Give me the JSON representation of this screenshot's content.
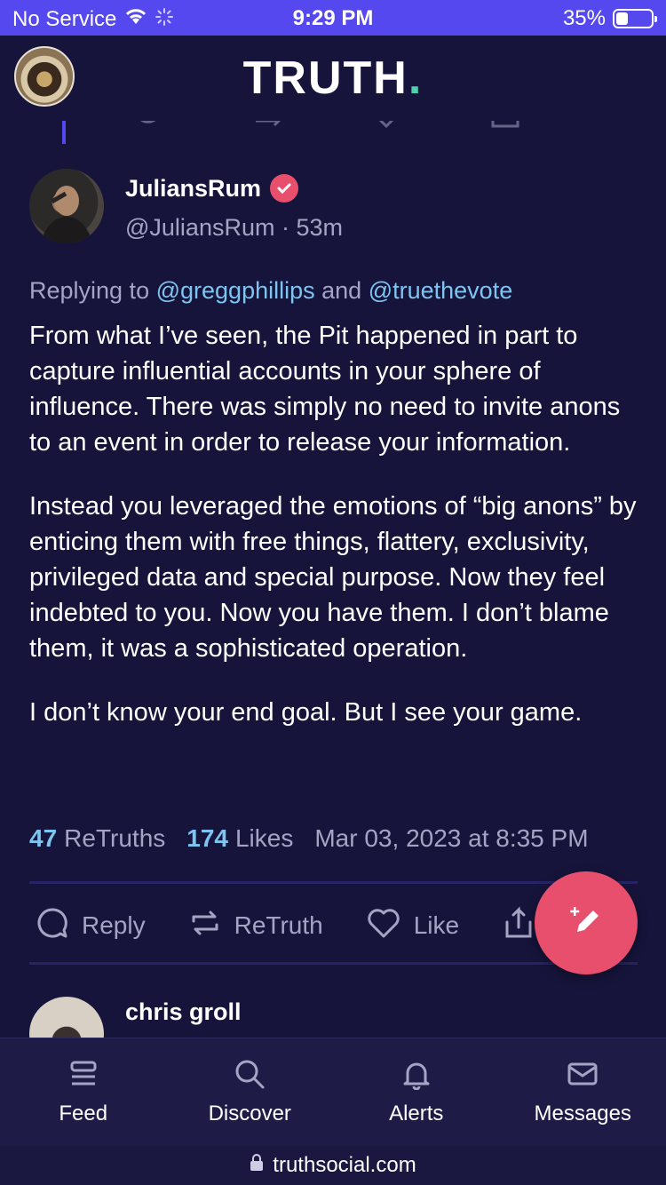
{
  "status_bar": {
    "carrier": "No Service",
    "time": "9:29 PM",
    "battery_percent": "35%",
    "battery_level": 0.35
  },
  "header": {
    "logo_text": "TRUTH",
    "logo_dot": "."
  },
  "post": {
    "author_name": "JuliansRum",
    "handle": "@JuliansRum",
    "separator": "·",
    "age": "53m",
    "replying_prefix": "Replying to",
    "replying_mentions": [
      "@greggphillips",
      "@truethevote"
    ],
    "replying_joiner": "and",
    "paragraphs": [
      "From what I’ve seen, the Pit happened in part to capture influential accounts in your sphere of influence. There was simply no need to invite anons to an event in order to release your information.",
      "Instead you leveraged the emotions of “big anons” by enticing them with free things, flattery, exclusivity, privileged data and special purpose. Now they feel indebted to you. Now you have them. I don’t blame them, it was a sophisticated operation.",
      "I don’t know your end goal. But I see your game."
    ],
    "retruths_count": "47",
    "retruths_label": "ReTruths",
    "likes_count": "174",
    "likes_label": "Likes",
    "timestamp": "Mar 03, 2023 at 8:35 PM"
  },
  "actions": {
    "reply": "Reply",
    "retruth": "ReTruth",
    "like": "Like"
  },
  "next_post": {
    "author_name": "chris groll"
  },
  "bottom_nav": {
    "items": [
      {
        "label": "Feed",
        "icon": "feed-icon"
      },
      {
        "label": "Discover",
        "icon": "search-icon"
      },
      {
        "label": "Alerts",
        "icon": "bell-icon"
      },
      {
        "label": "Messages",
        "icon": "envelope-icon"
      }
    ]
  },
  "url_bar": {
    "url": "truthsocial.com"
  },
  "colors": {
    "background": "#16143a",
    "status_bar": "#5448ee",
    "accent_pink": "#e84f6c",
    "link_blue": "#7ec4f0",
    "muted_text": "#a6a4c4",
    "logo_dot": "#4ed1b0"
  }
}
